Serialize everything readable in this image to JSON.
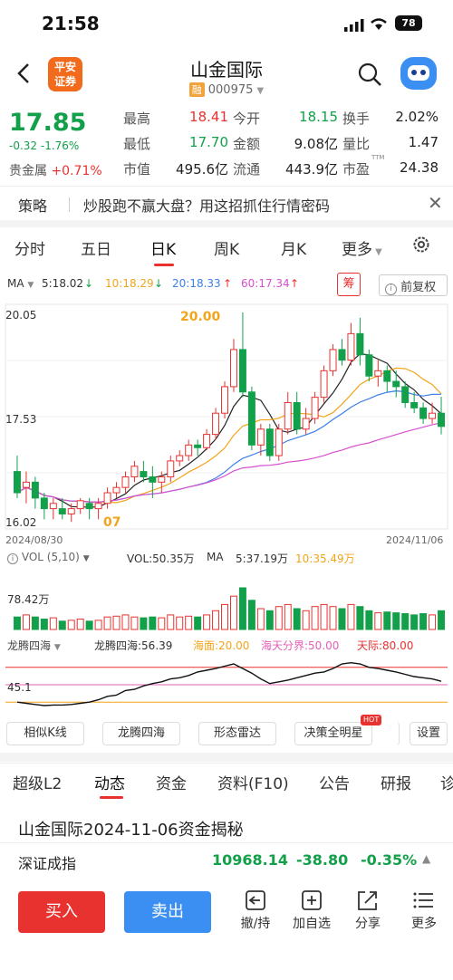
{
  "status": {
    "time": "21:58",
    "battery": "78"
  },
  "header": {
    "logo_line1": "平安",
    "logo_line2": "证券",
    "title": "山金国际",
    "tag": "融",
    "code": "000975"
  },
  "quote": {
    "price": "17.85",
    "change": "-0.32 -1.76%",
    "sector_label": "贵金属",
    "sector_change": "+0.71%",
    "fields": [
      {
        "label": "最高",
        "value": "18.41",
        "color": "#e8322f"
      },
      {
        "label": "今开",
        "value": "18.15",
        "color": "#12a04a"
      },
      {
        "label": "换手",
        "value": "2.02%",
        "color": "#222"
      },
      {
        "label": "最低",
        "value": "17.70",
        "color": "#12a04a"
      },
      {
        "label": "金额",
        "value": "9.08亿",
        "color": "#222"
      },
      {
        "label": "量比",
        "value": "1.47",
        "color": "#222"
      },
      {
        "label": "市值",
        "value": "495.6亿",
        "color": "#222"
      },
      {
        "label": "流通",
        "value": "443.9亿",
        "color": "#222"
      },
      {
        "label": "市盈",
        "value": "24.38",
        "color": "#222"
      }
    ],
    "pe_sup": "TTM"
  },
  "promo": {
    "tag": "策略",
    "text": "炒股跑不赢大盘？用这招抓住行情密码"
  },
  "period_tabs": [
    "分时",
    "五日",
    "日K",
    "周K",
    "月K",
    "更多"
  ],
  "ma": {
    "label": "MA",
    "ma5": "5:18.02",
    "ma10": "10:18.29",
    "ma20": "20:18.33",
    "ma60": "60:17.34",
    "chou": "筹",
    "fuquan": "前复权"
  },
  "kchart": {
    "y_high": "20.05",
    "y_mid": "17.53",
    "y_low": "16.02",
    "peak_label": "20.00",
    "low_label": "07",
    "date_start": "2024/08/30",
    "date_end": "2024/11/06"
  },
  "vol": {
    "label": "VOL (5,10)",
    "vol": "VOL:50.35万",
    "ma_label": "MA",
    "ma5": "5:37.19万",
    "ma10": "10:35.49万",
    "y_label": "78.42万"
  },
  "longteng": {
    "label": "龙腾四海",
    "value": "龙腾四海:56.39",
    "haimian": "海面:20.00",
    "haitian": "海天分界:50.00",
    "tianji": "天际:80.00",
    "y_label": "45.1"
  },
  "tools": [
    "相似K线",
    "龙腾四海",
    "形态雷达",
    "决策全明星",
    "设置"
  ],
  "hot_badge": "HOT",
  "bottom_tabs": [
    "超级L2",
    "动态",
    "资金",
    "资料(F10)",
    "公告",
    "研报",
    "诊"
  ],
  "article_title": "山金国际2024-11-06资金揭秘",
  "index": {
    "name": "深证成指",
    "value": "10968.14",
    "change": "-38.80",
    "pct": "-0.35%"
  },
  "actions": {
    "buy": "买入",
    "sell": "卖出",
    "items": [
      "撤/持",
      "加自选",
      "分享",
      "更多"
    ]
  },
  "chart_data": {
    "type": "candlestick",
    "ma_legend": [
      "5:18.02",
      "10:18.29",
      "20:18.33",
      "60:17.34"
    ],
    "ylim": [
      16.02,
      20.05
    ],
    "date_range": [
      "2024/08/30",
      "2024/11/06"
    ],
    "candles": [
      {
        "o": 17.0,
        "c": 16.6,
        "h": 17.3,
        "l": 16.5
      },
      {
        "o": 16.7,
        "c": 16.8,
        "h": 17.0,
        "l": 16.4
      },
      {
        "o": 16.8,
        "c": 16.5,
        "h": 16.9,
        "l": 16.3
      },
      {
        "o": 16.5,
        "c": 16.3,
        "h": 16.6,
        "l": 16.1
      },
      {
        "o": 16.3,
        "c": 16.4,
        "h": 16.5,
        "l": 16.1
      },
      {
        "o": 16.3,
        "c": 16.2,
        "h": 16.5,
        "l": 16.1
      },
      {
        "o": 16.2,
        "c": 16.3,
        "h": 16.4,
        "l": 16.05
      },
      {
        "o": 16.3,
        "c": 16.45,
        "h": 16.5,
        "l": 16.2
      },
      {
        "o": 16.4,
        "c": 16.3,
        "h": 16.5,
        "l": 16.1
      },
      {
        "o": 16.3,
        "c": 16.4,
        "h": 16.5,
        "l": 16.1
      },
      {
        "o": 16.4,
        "c": 16.6,
        "h": 16.7,
        "l": 16.3
      },
      {
        "o": 16.6,
        "c": 16.7,
        "h": 16.8,
        "l": 16.5
      },
      {
        "o": 16.7,
        "c": 16.9,
        "h": 17.0,
        "l": 16.6
      },
      {
        "o": 16.9,
        "c": 17.1,
        "h": 17.2,
        "l": 16.8
      },
      {
        "o": 17.0,
        "c": 16.9,
        "h": 17.2,
        "l": 16.8
      },
      {
        "o": 16.9,
        "c": 16.8,
        "h": 17.1,
        "l": 16.5
      },
      {
        "o": 16.8,
        "c": 16.9,
        "h": 17.0,
        "l": 16.6
      },
      {
        "o": 16.9,
        "c": 17.2,
        "h": 17.3,
        "l": 16.8
      },
      {
        "o": 17.2,
        "c": 17.3,
        "h": 17.4,
        "l": 17.1
      },
      {
        "o": 17.3,
        "c": 17.5,
        "h": 17.6,
        "l": 17.2
      },
      {
        "o": 17.5,
        "c": 17.45,
        "h": 17.6,
        "l": 17.3
      },
      {
        "o": 17.45,
        "c": 17.7,
        "h": 17.8,
        "l": 17.4
      },
      {
        "o": 17.7,
        "c": 18.1,
        "h": 18.2,
        "l": 17.6
      },
      {
        "o": 18.1,
        "c": 18.6,
        "h": 18.7,
        "l": 18.0
      },
      {
        "o": 18.6,
        "c": 19.3,
        "h": 19.5,
        "l": 18.5
      },
      {
        "o": 19.3,
        "c": 18.5,
        "h": 20.0,
        "l": 18.4
      },
      {
        "o": 18.5,
        "c": 17.5,
        "h": 18.6,
        "l": 17.4
      },
      {
        "o": 17.5,
        "c": 17.8,
        "h": 17.9,
        "l": 17.3
      },
      {
        "o": 17.8,
        "c": 17.3,
        "h": 17.9,
        "l": 17.2
      },
      {
        "o": 17.3,
        "c": 17.8,
        "h": 17.9,
        "l": 17.2
      },
      {
        "o": 17.8,
        "c": 18.3,
        "h": 18.5,
        "l": 17.7
      },
      {
        "o": 18.3,
        "c": 17.8,
        "h": 18.5,
        "l": 17.7
      },
      {
        "o": 17.8,
        "c": 18.0,
        "h": 18.2,
        "l": 17.7
      },
      {
        "o": 18.0,
        "c": 18.4,
        "h": 18.5,
        "l": 17.9
      },
      {
        "o": 18.4,
        "c": 18.9,
        "h": 19.0,
        "l": 18.3
      },
      {
        "o": 18.9,
        "c": 19.3,
        "h": 19.4,
        "l": 18.8
      },
      {
        "o": 19.3,
        "c": 19.1,
        "h": 19.5,
        "l": 19.0
      },
      {
        "o": 19.1,
        "c": 19.6,
        "h": 19.8,
        "l": 19.0
      },
      {
        "o": 19.6,
        "c": 19.2,
        "h": 19.9,
        "l": 19.0
      },
      {
        "o": 19.2,
        "c": 18.8,
        "h": 19.3,
        "l": 18.7
      },
      {
        "o": 18.8,
        "c": 18.9,
        "h": 19.1,
        "l": 18.6
      },
      {
        "o": 18.9,
        "c": 18.7,
        "h": 19.0,
        "l": 18.5
      },
      {
        "o": 18.7,
        "c": 18.6,
        "h": 18.9,
        "l": 18.4
      },
      {
        "o": 18.6,
        "c": 18.3,
        "h": 18.7,
        "l": 18.2
      },
      {
        "o": 18.3,
        "c": 18.2,
        "h": 18.5,
        "l": 18.1
      },
      {
        "o": 18.2,
        "c": 18.0,
        "h": 18.3,
        "l": 17.9
      },
      {
        "o": 18.0,
        "c": 18.1,
        "h": 18.3,
        "l": 17.9
      },
      {
        "o": 18.1,
        "c": 17.85,
        "h": 18.41,
        "l": 17.7
      }
    ]
  }
}
